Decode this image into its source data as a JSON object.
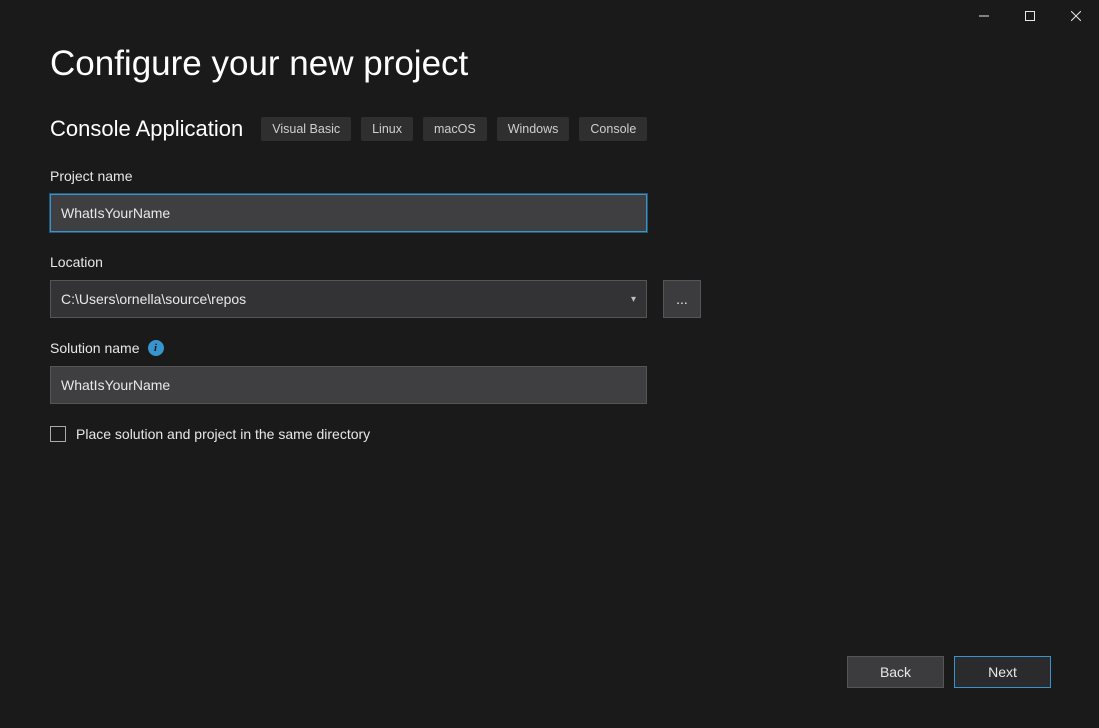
{
  "window": {
    "minimize_icon": "minimize",
    "maximize_icon": "maximize",
    "close_icon": "close"
  },
  "page": {
    "title": "Configure your new project",
    "subtitle": "Console Application",
    "tags": [
      "Visual Basic",
      "Linux",
      "macOS",
      "Windows",
      "Console"
    ]
  },
  "fields": {
    "project_name": {
      "label": "Project name",
      "value": "WhatIsYourName"
    },
    "location": {
      "label": "Location",
      "value": "C:\\Users\\ornella\\source\\repos",
      "browse_label": "..."
    },
    "solution_name": {
      "label": "Solution name",
      "value": "WhatIsYourName"
    },
    "same_dir": {
      "label": "Place solution and project in the same directory",
      "checked": false
    }
  },
  "footer": {
    "back": "Back",
    "next": "Next"
  }
}
